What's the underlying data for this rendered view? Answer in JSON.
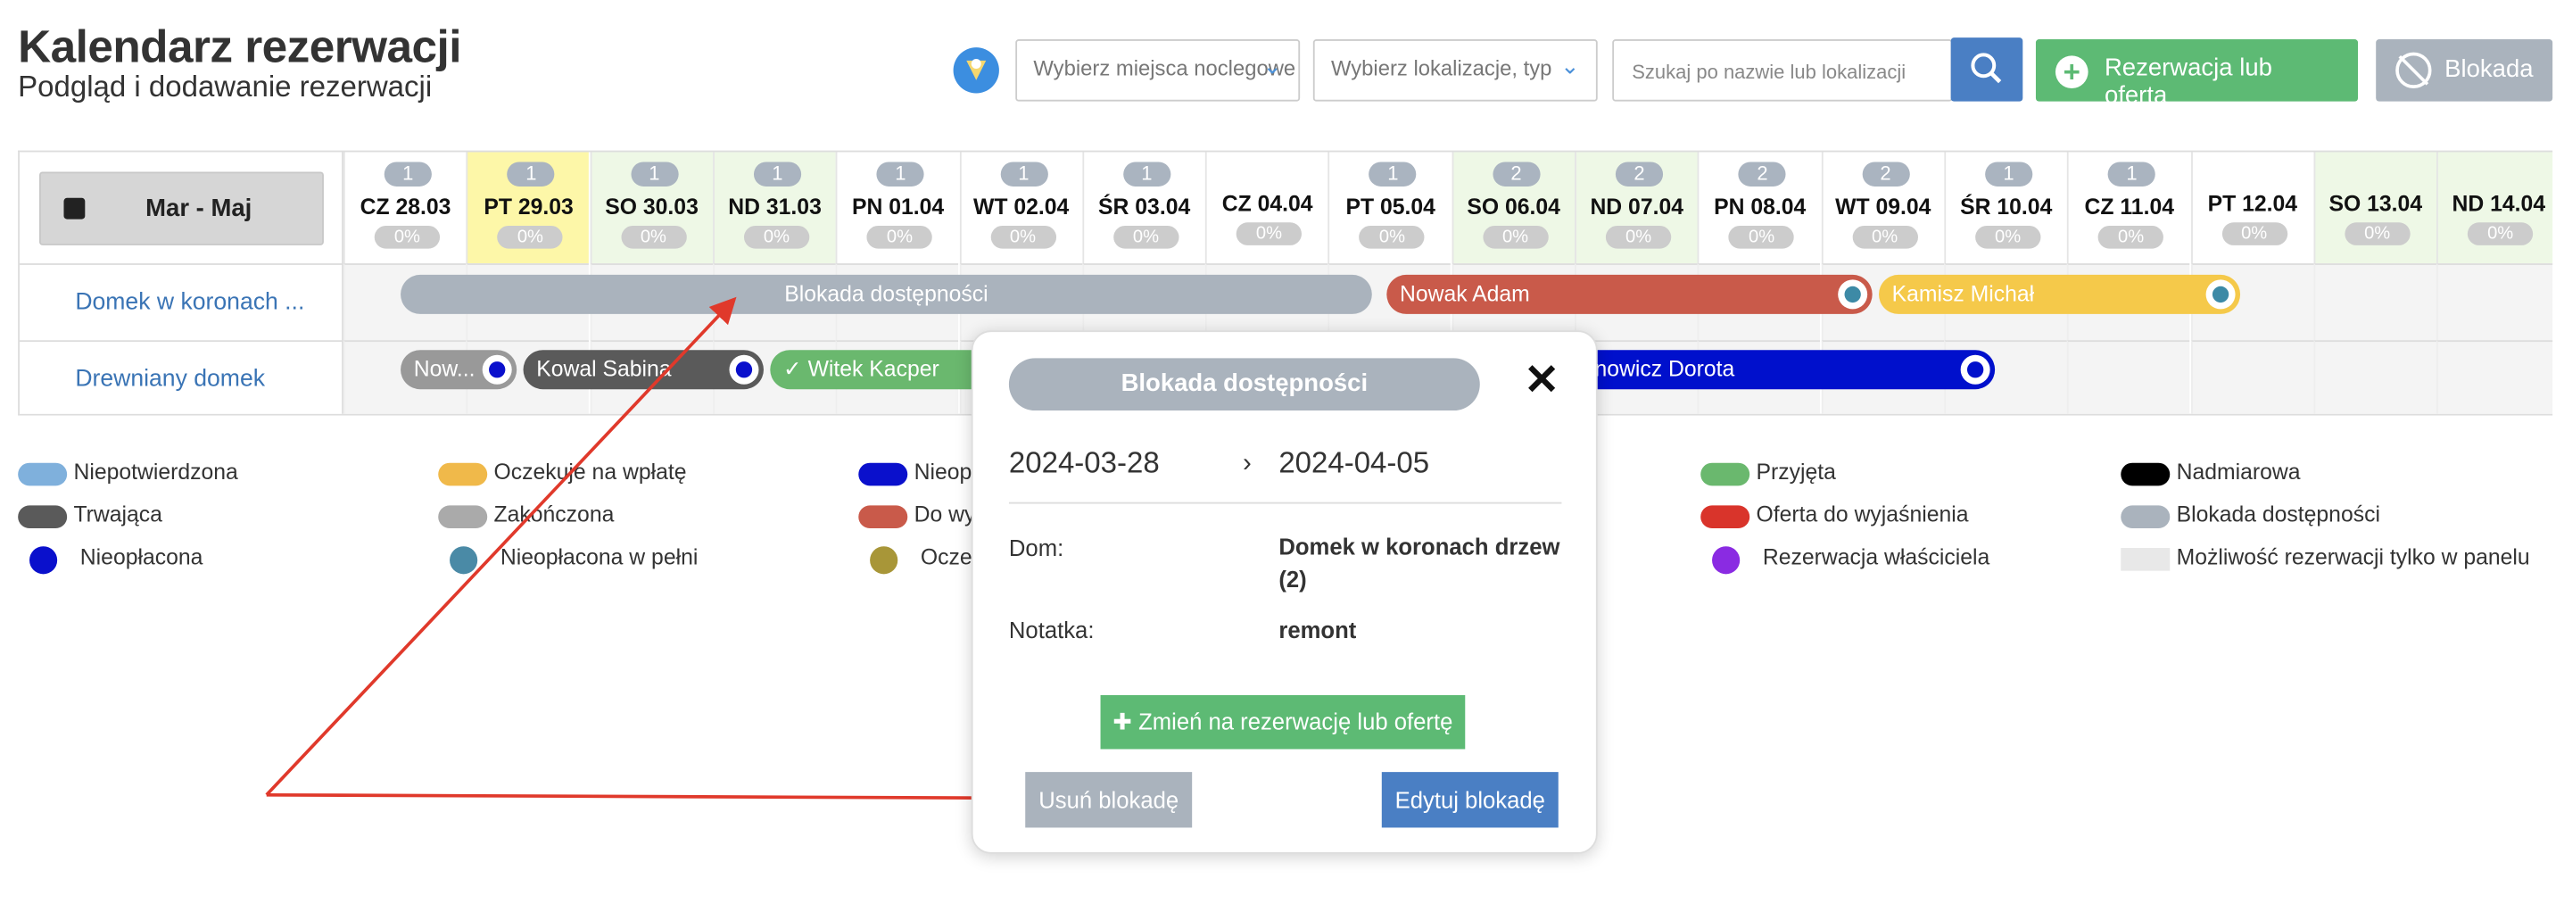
{
  "header": {
    "title": "Kalendarz rezerwacji",
    "subtitle": "Podgląd i dodawanie rezerwacji"
  },
  "filters": {
    "places_placeholder": "Wybierz miejsca noclegowe",
    "locations_placeholder": "Wybierz lokalizacje, typ",
    "search_placeholder": "Szukaj po nazwie lub lokalizacji"
  },
  "actions": {
    "add_label": "Rezerwacja lub oferta",
    "block_label": "Blokada"
  },
  "calendar": {
    "range_label": "Mar - Maj",
    "rows": [
      "Domek w koronach ...",
      "Drewniany domek"
    ],
    "days": [
      {
        "label": "CZ 28.03",
        "count": "1",
        "pct": "0%"
      },
      {
        "label": "PT 29.03",
        "count": "1",
        "pct": "0%"
      },
      {
        "label": "SO 30.03",
        "count": "1",
        "pct": "0%"
      },
      {
        "label": "ND 31.03",
        "count": "1",
        "pct": "0%"
      },
      {
        "label": "PN 01.04",
        "count": "1",
        "pct": "0%"
      },
      {
        "label": "WT 02.04",
        "count": "1",
        "pct": "0%"
      },
      {
        "label": "ŚR 03.04",
        "count": "1",
        "pct": "0%"
      },
      {
        "label": "CZ 04.04",
        "count": "",
        "pct": "0%"
      },
      {
        "label": "PT 05.04",
        "count": "1",
        "pct": "0%"
      },
      {
        "label": "SO 06.04",
        "count": "2",
        "pct": "0%"
      },
      {
        "label": "ND 07.04",
        "count": "2",
        "pct": "0%"
      },
      {
        "label": "PN 08.04",
        "count": "2",
        "pct": "0%"
      },
      {
        "label": "WT 09.04",
        "count": "2",
        "pct": "0%"
      },
      {
        "label": "ŚR 10.04",
        "count": "1",
        "pct": "0%"
      },
      {
        "label": "CZ 11.04",
        "count": "1",
        "pct": "0%"
      },
      {
        "label": "PT 12.04",
        "count": "",
        "pct": "0%"
      },
      {
        "label": "SO 13.04",
        "count": "",
        "pct": "0%"
      },
      {
        "label": "ND 14.04",
        "count": "",
        "pct": "0%"
      }
    ],
    "bars": {
      "blokada": "Blokada dostępności",
      "nowak": "Nowak Adam",
      "kamisz": "Kamisz Michał",
      "now": "Now...",
      "kowal": "Kowal Sabina",
      "witek": "✓ Witek Kacper",
      "dorota": "...nowicz Dorota"
    }
  },
  "legend": [
    "Niepotwierdzona",
    "Oczekuje na wpłatę",
    "Niepotwierdzona przez klienta",
    "",
    "Przyjęta",
    "Nadmiarowa",
    "Trwająca",
    "Zakończona",
    "Do wyjaśnienia",
    "",
    "Oferta do wyjaśnienia",
    "Blokada dostępności",
    "Nieopłacona",
    "Nieopłacona w pełni",
    "Oczekuje na dopłatę",
    "",
    "Rezerwacja właściciela",
    "Możliwość rezerwacji tylko w panelu"
  ],
  "legend_visible": {
    "l2": "Nieop",
    "l8": "Do wy",
    "l14": "Oczek"
  },
  "popup": {
    "title": "Blokada dostępności",
    "date_from": "2024-03-28",
    "date_to": "2024-04-05",
    "dom_label": "Dom:",
    "dom_value": "Domek w koronach drzew (2)",
    "note_label": "Notatka:",
    "note_value": "remont",
    "convert_label": "Zmień na rezerwację lub ofertę",
    "remove_label": "Usuń blokadę",
    "edit_label": "Edytuj blokadę"
  },
  "colors": {
    "accent_green": "#5dba74",
    "accent_blue": "#4a7fc4",
    "block_gray": "#aab3bd",
    "annotation_red": "#e0392b"
  }
}
